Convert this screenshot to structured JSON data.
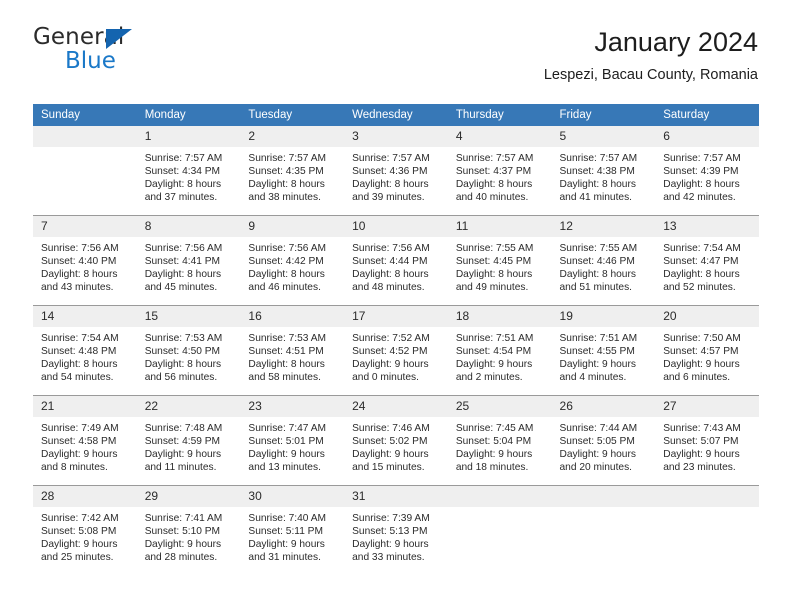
{
  "brand": {
    "word1": "General",
    "word2": "Blue",
    "triangle_color": "#1464af",
    "blue_color": "#1a78c8"
  },
  "header": {
    "title": "January 2024",
    "subtitle": "Lespezi, Bacau County, Romania"
  },
  "theme": {
    "header_bg": "#3778b7",
    "header_text": "#ffffff",
    "date_band_bg": "#efefef",
    "week_rule": "#9a9a9a",
    "bottom_rule": "#1c5f9e"
  },
  "weekdays": [
    "Sunday",
    "Monday",
    "Tuesday",
    "Wednesday",
    "Thursday",
    "Friday",
    "Saturday"
  ],
  "weeks": [
    {
      "days": [
        {
          "date": "",
          "lines": [
            "",
            "",
            "",
            ""
          ]
        },
        {
          "date": "1",
          "lines": [
            "Sunrise: 7:57 AM",
            "Sunset: 4:34 PM",
            "Daylight: 8 hours",
            "and 37 minutes."
          ]
        },
        {
          "date": "2",
          "lines": [
            "Sunrise: 7:57 AM",
            "Sunset: 4:35 PM",
            "Daylight: 8 hours",
            "and 38 minutes."
          ]
        },
        {
          "date": "3",
          "lines": [
            "Sunrise: 7:57 AM",
            "Sunset: 4:36 PM",
            "Daylight: 8 hours",
            "and 39 minutes."
          ]
        },
        {
          "date": "4",
          "lines": [
            "Sunrise: 7:57 AM",
            "Sunset: 4:37 PM",
            "Daylight: 8 hours",
            "and 40 minutes."
          ]
        },
        {
          "date": "5",
          "lines": [
            "Sunrise: 7:57 AM",
            "Sunset: 4:38 PM",
            "Daylight: 8 hours",
            "and 41 minutes."
          ]
        },
        {
          "date": "6",
          "lines": [
            "Sunrise: 7:57 AM",
            "Sunset: 4:39 PM",
            "Daylight: 8 hours",
            "and 42 minutes."
          ]
        }
      ]
    },
    {
      "days": [
        {
          "date": "7",
          "lines": [
            "Sunrise: 7:56 AM",
            "Sunset: 4:40 PM",
            "Daylight: 8 hours",
            "and 43 minutes."
          ]
        },
        {
          "date": "8",
          "lines": [
            "Sunrise: 7:56 AM",
            "Sunset: 4:41 PM",
            "Daylight: 8 hours",
            "and 45 minutes."
          ]
        },
        {
          "date": "9",
          "lines": [
            "Sunrise: 7:56 AM",
            "Sunset: 4:42 PM",
            "Daylight: 8 hours",
            "and 46 minutes."
          ]
        },
        {
          "date": "10",
          "lines": [
            "Sunrise: 7:56 AM",
            "Sunset: 4:44 PM",
            "Daylight: 8 hours",
            "and 48 minutes."
          ]
        },
        {
          "date": "11",
          "lines": [
            "Sunrise: 7:55 AM",
            "Sunset: 4:45 PM",
            "Daylight: 8 hours",
            "and 49 minutes."
          ]
        },
        {
          "date": "12",
          "lines": [
            "Sunrise: 7:55 AM",
            "Sunset: 4:46 PM",
            "Daylight: 8 hours",
            "and 51 minutes."
          ]
        },
        {
          "date": "13",
          "lines": [
            "Sunrise: 7:54 AM",
            "Sunset: 4:47 PM",
            "Daylight: 8 hours",
            "and 52 minutes."
          ]
        }
      ]
    },
    {
      "days": [
        {
          "date": "14",
          "lines": [
            "Sunrise: 7:54 AM",
            "Sunset: 4:48 PM",
            "Daylight: 8 hours",
            "and 54 minutes."
          ]
        },
        {
          "date": "15",
          "lines": [
            "Sunrise: 7:53 AM",
            "Sunset: 4:50 PM",
            "Daylight: 8 hours",
            "and 56 minutes."
          ]
        },
        {
          "date": "16",
          "lines": [
            "Sunrise: 7:53 AM",
            "Sunset: 4:51 PM",
            "Daylight: 8 hours",
            "and 58 minutes."
          ]
        },
        {
          "date": "17",
          "lines": [
            "Sunrise: 7:52 AM",
            "Sunset: 4:52 PM",
            "Daylight: 9 hours",
            "and 0 minutes."
          ]
        },
        {
          "date": "18",
          "lines": [
            "Sunrise: 7:51 AM",
            "Sunset: 4:54 PM",
            "Daylight: 9 hours",
            "and 2 minutes."
          ]
        },
        {
          "date": "19",
          "lines": [
            "Sunrise: 7:51 AM",
            "Sunset: 4:55 PM",
            "Daylight: 9 hours",
            "and 4 minutes."
          ]
        },
        {
          "date": "20",
          "lines": [
            "Sunrise: 7:50 AM",
            "Sunset: 4:57 PM",
            "Daylight: 9 hours",
            "and 6 minutes."
          ]
        }
      ]
    },
    {
      "days": [
        {
          "date": "21",
          "lines": [
            "Sunrise: 7:49 AM",
            "Sunset: 4:58 PM",
            "Daylight: 9 hours",
            "and 8 minutes."
          ]
        },
        {
          "date": "22",
          "lines": [
            "Sunrise: 7:48 AM",
            "Sunset: 4:59 PM",
            "Daylight: 9 hours",
            "and 11 minutes."
          ]
        },
        {
          "date": "23",
          "lines": [
            "Sunrise: 7:47 AM",
            "Sunset: 5:01 PM",
            "Daylight: 9 hours",
            "and 13 minutes."
          ]
        },
        {
          "date": "24",
          "lines": [
            "Sunrise: 7:46 AM",
            "Sunset: 5:02 PM",
            "Daylight: 9 hours",
            "and 15 minutes."
          ]
        },
        {
          "date": "25",
          "lines": [
            "Sunrise: 7:45 AM",
            "Sunset: 5:04 PM",
            "Daylight: 9 hours",
            "and 18 minutes."
          ]
        },
        {
          "date": "26",
          "lines": [
            "Sunrise: 7:44 AM",
            "Sunset: 5:05 PM",
            "Daylight: 9 hours",
            "and 20 minutes."
          ]
        },
        {
          "date": "27",
          "lines": [
            "Sunrise: 7:43 AM",
            "Sunset: 5:07 PM",
            "Daylight: 9 hours",
            "and 23 minutes."
          ]
        }
      ]
    },
    {
      "days": [
        {
          "date": "28",
          "lines": [
            "Sunrise: 7:42 AM",
            "Sunset: 5:08 PM",
            "Daylight: 9 hours",
            "and 25 minutes."
          ]
        },
        {
          "date": "29",
          "lines": [
            "Sunrise: 7:41 AM",
            "Sunset: 5:10 PM",
            "Daylight: 9 hours",
            "and 28 minutes."
          ]
        },
        {
          "date": "30",
          "lines": [
            "Sunrise: 7:40 AM",
            "Sunset: 5:11 PM",
            "Daylight: 9 hours",
            "and 31 minutes."
          ]
        },
        {
          "date": "31",
          "lines": [
            "Sunrise: 7:39 AM",
            "Sunset: 5:13 PM",
            "Daylight: 9 hours",
            "and 33 minutes."
          ]
        },
        {
          "date": "",
          "lines": [
            "",
            "",
            "",
            ""
          ]
        },
        {
          "date": "",
          "lines": [
            "",
            "",
            "",
            ""
          ]
        },
        {
          "date": "",
          "lines": [
            "",
            "",
            "",
            ""
          ]
        }
      ]
    }
  ]
}
